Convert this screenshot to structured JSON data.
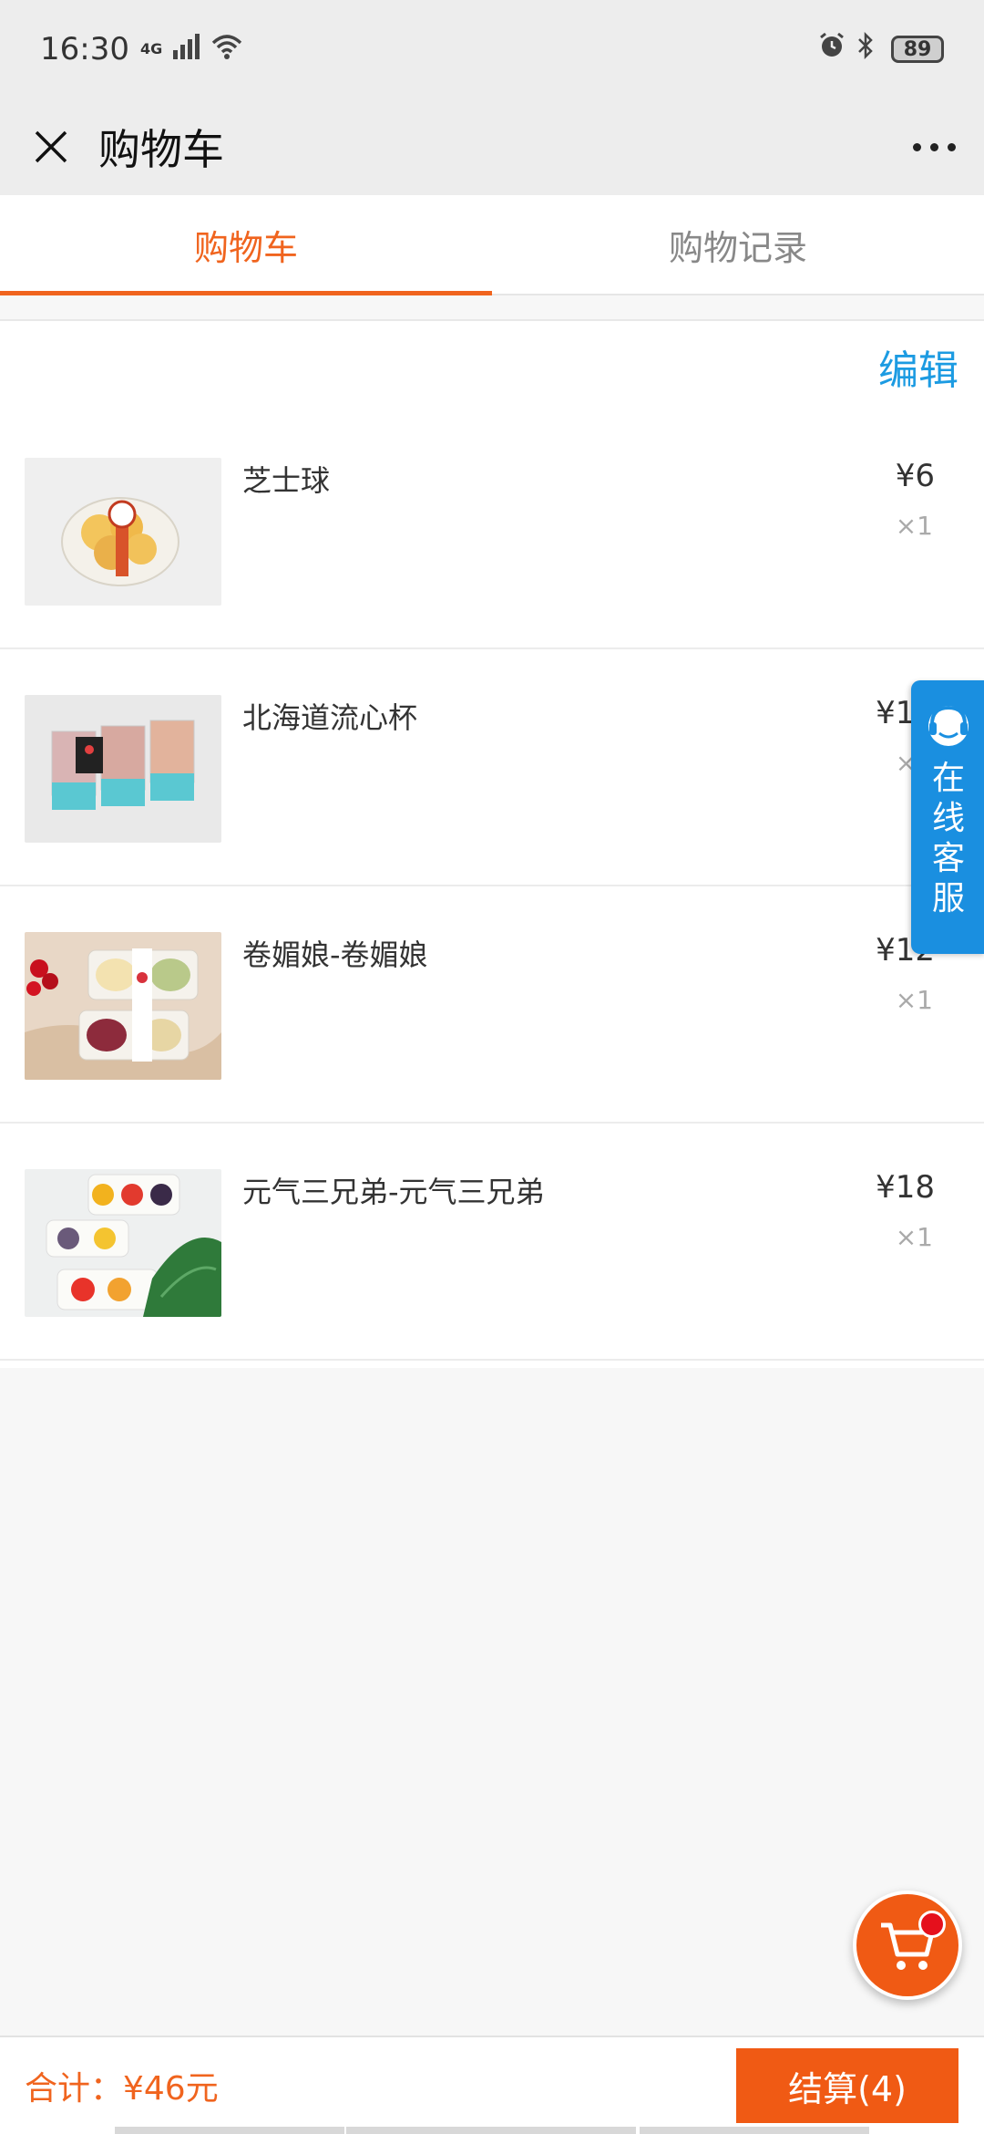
{
  "status_bar": {
    "time": "16:30",
    "network": "4G",
    "battery": "89"
  },
  "header": {
    "title": "购物车"
  },
  "tabs": [
    {
      "label": "购物车"
    },
    {
      "label": "购物记录"
    }
  ],
  "cart": {
    "edit_label": "编辑",
    "items": [
      {
        "name": "芝士球",
        "price": "¥6",
        "qty": "×1"
      },
      {
        "name": "北海道流心杯",
        "price": "¥10",
        "qty": "×1"
      },
      {
        "name": "卷媚娘-卷媚娘",
        "price": "¥12",
        "qty": "×1"
      },
      {
        "name": "元气三兄弟-元气三兄弟",
        "price": "¥18",
        "qty": "×1"
      }
    ]
  },
  "customer_service": {
    "label": "在线客服"
  },
  "footer": {
    "total_label": "合计：¥46元",
    "checkout_label": "结算(4)"
  },
  "colors": {
    "accent": "#f0641e",
    "link": "#1c9be2",
    "service": "#1a8fe0"
  }
}
